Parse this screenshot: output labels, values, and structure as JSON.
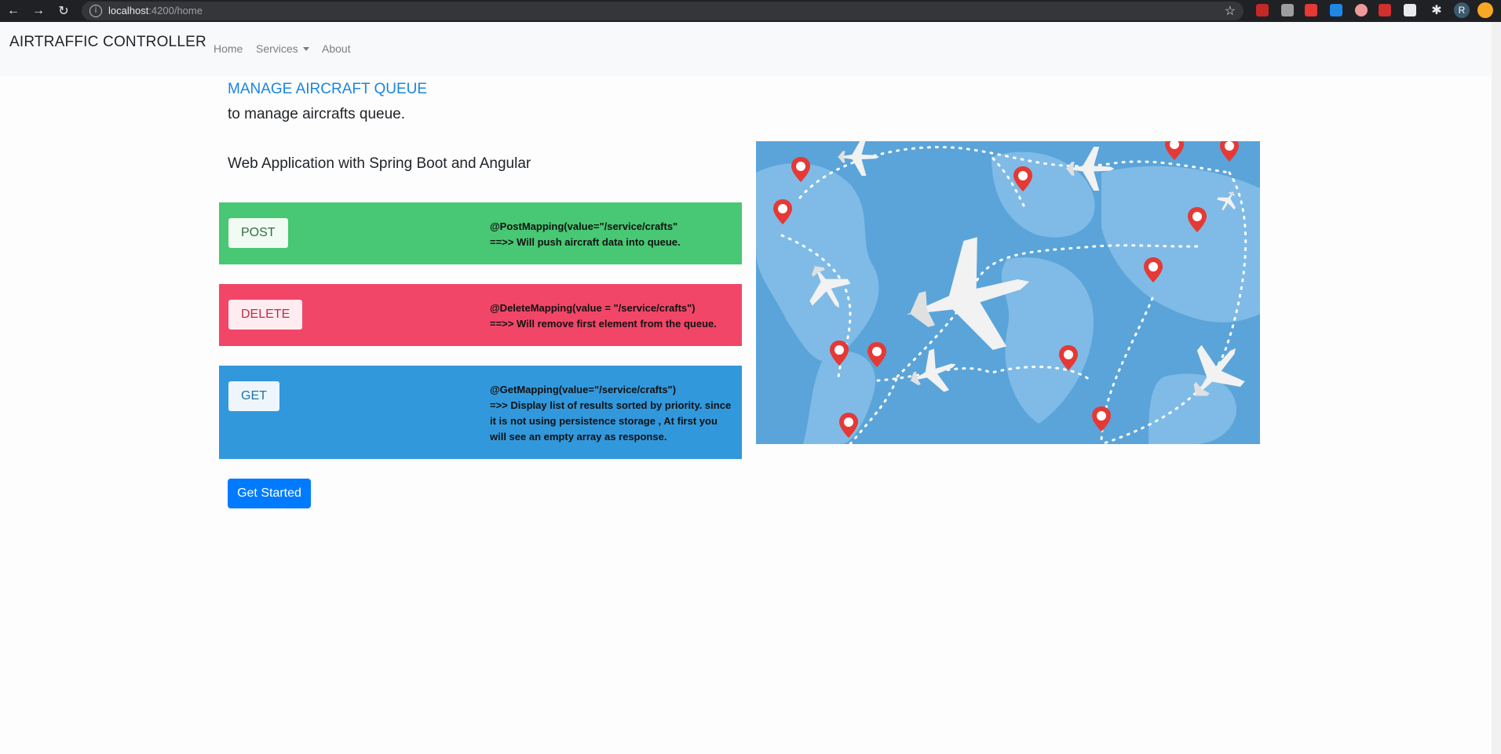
{
  "browser": {
    "url_host": "localhost",
    "url_rest": ":4200/home",
    "info_glyph": "i",
    "avatar_letter": "R"
  },
  "navbar": {
    "brand": "AIRTRAFFIC CONTROLLER",
    "links": [
      "Home",
      "Services",
      "About"
    ]
  },
  "main": {
    "heading": "MANAGE AIRCRAFT QUEUE",
    "subheading": "to manage aircrafts queue.",
    "tagline": "Web Application with Spring Boot and Angular",
    "cards": [
      {
        "button": "POST",
        "mapping": "@PostMapping(value=\"/service/crafts\"",
        "description": "==>> Will push aircraft data into queue."
      },
      {
        "button": "DELETE",
        "mapping": "@DeleteMapping(value = \"/service/crafts\")",
        "description": "==>> Will remove first element from the queue."
      },
      {
        "button": "GET",
        "mapping": "@GetMapping(value=\"/service/crafts\")",
        "description": "=>> Display list of results sorted by priority. since it is not using persistence storage , At first you will see an empty array as response."
      }
    ],
    "get_started": "Get Started"
  },
  "colors": {
    "post": "#48c774",
    "delete": "#f14668",
    "get": "#3298dc",
    "primary": "#007bff",
    "heading": "#1a85e0"
  },
  "icons": [
    "back-arrow-icon",
    "forward-arrow-icon",
    "reload-icon",
    "info-icon",
    "bookmark-star-icon",
    "extension-puzzle-icon",
    "profile-avatar",
    "map-pin-icon",
    "airplane-icon"
  ]
}
